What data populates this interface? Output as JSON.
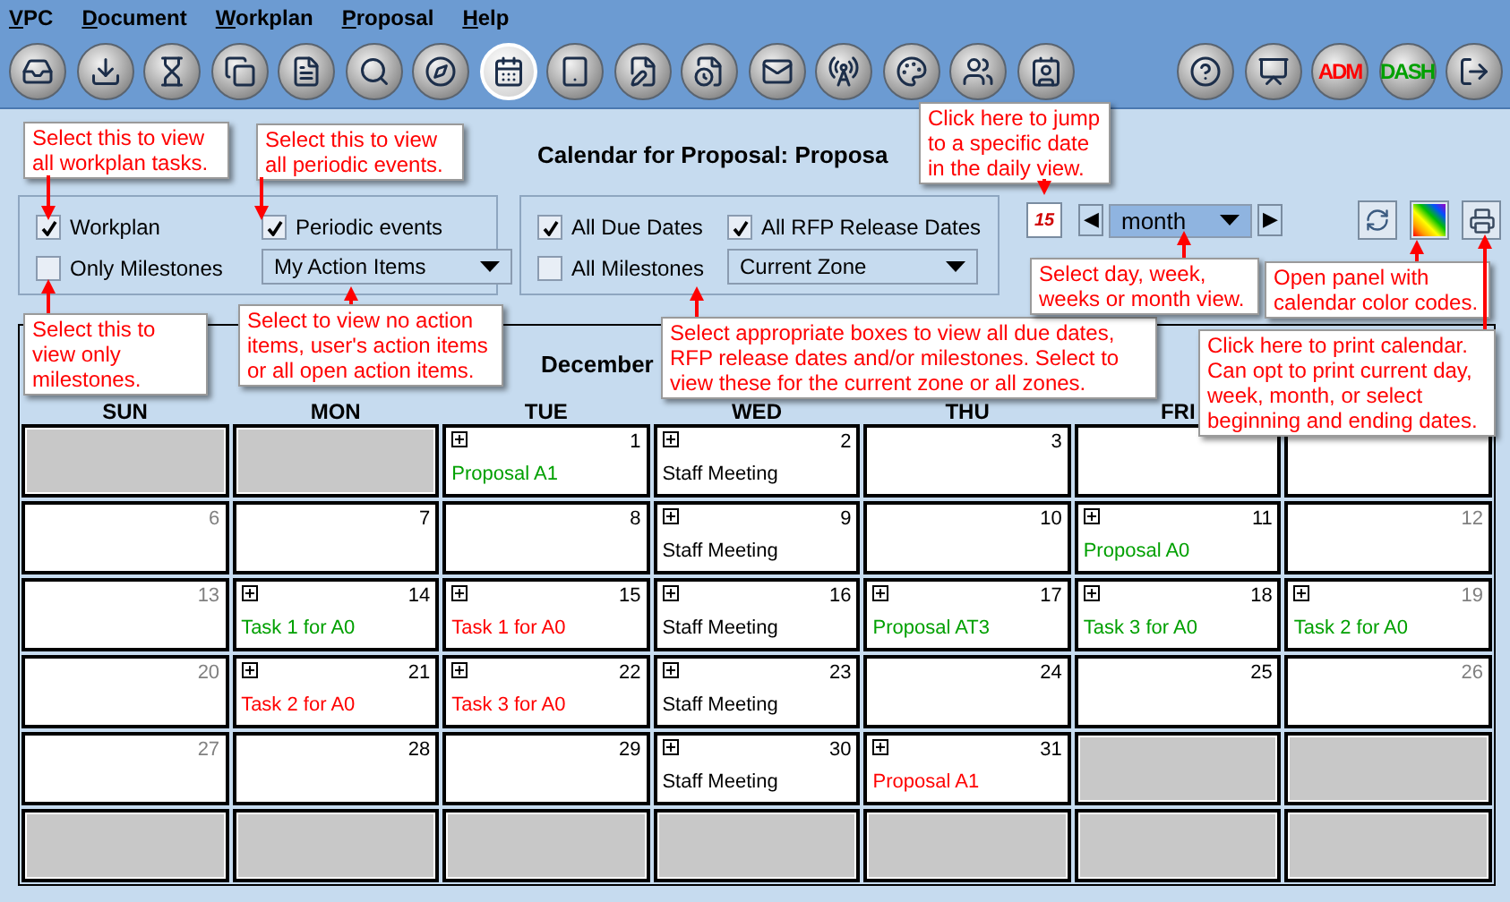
{
  "menu": [
    {
      "label": "VPC"
    },
    {
      "label": "Document"
    },
    {
      "label": "Workplan"
    },
    {
      "label": "Proposal"
    },
    {
      "label": "Help"
    }
  ],
  "toolbar": {
    "left": [
      {
        "kind": "icon",
        "selected": false
      },
      {
        "kind": "icon",
        "selected": false
      },
      {
        "kind": "icon",
        "selected": false
      },
      {
        "kind": "icon",
        "selected": false
      },
      {
        "kind": "icon",
        "selected": false
      },
      {
        "kind": "icon",
        "selected": false
      },
      {
        "kind": "icon",
        "selected": false
      },
      {
        "kind": "icon",
        "selected": true
      },
      {
        "kind": "icon",
        "selected": false
      },
      {
        "kind": "icon",
        "selected": false
      },
      {
        "kind": "icon",
        "selected": false
      },
      {
        "kind": "icon",
        "selected": false
      },
      {
        "kind": "icon",
        "selected": false
      },
      {
        "kind": "icon",
        "selected": false
      },
      {
        "kind": "icon",
        "selected": false
      },
      {
        "kind": "icon",
        "selected": false
      }
    ],
    "right": [
      {
        "kind": "icon",
        "selected": false
      },
      {
        "kind": "icon",
        "selected": false
      },
      {
        "kind": "text",
        "label": "ADM",
        "selected": false
      },
      {
        "kind": "text",
        "label": "DASH",
        "selected": false
      },
      {
        "kind": "icon",
        "selected": false
      }
    ]
  },
  "title": "Calendar for Proposal: Proposa",
  "filters": {
    "left": {
      "checkboxes": [
        {
          "label": "Workplan",
          "checked": true
        },
        {
          "label": "Periodic events",
          "checked": true
        },
        {
          "label": "Only Milestones",
          "checked": false
        }
      ],
      "dropdown": {
        "value": "My Action Items"
      }
    },
    "right": {
      "checkboxes": [
        {
          "label": "All Due Dates",
          "checked": true
        },
        {
          "label": "All RFP Release Dates",
          "checked": true
        },
        {
          "label": "All Milestones",
          "checked": false
        }
      ],
      "dropdown": {
        "value": "Current Zone"
      }
    }
  },
  "view": {
    "date_button": "15",
    "prev": "◀",
    "mode": "month",
    "next": "▶"
  },
  "calendar": {
    "month": "December",
    "weekdays": [
      "SUN",
      "MON",
      "TUE",
      "WED",
      "THU",
      "FRI"
    ],
    "weeks": [
      [
        {
          "kind": "blank"
        },
        {
          "kind": "blank"
        },
        {
          "kind": "day",
          "day": "1",
          "expandable": true,
          "event": "Proposal A1",
          "color": "#00a000"
        },
        {
          "kind": "day",
          "day": "2",
          "expandable": true,
          "event": "Staff Meeting",
          "color": "#000000"
        },
        {
          "kind": "day",
          "day": "3",
          "expandable": false
        },
        {
          "kind": "day",
          "expandable": false
        },
        {
          "kind": "day",
          "expandable": false
        }
      ],
      [
        {
          "kind": "day",
          "day": "6",
          "expandable": false
        },
        {
          "kind": "day",
          "day": "7",
          "expandable": false
        },
        {
          "kind": "day",
          "day": "8",
          "expandable": false
        },
        {
          "kind": "day",
          "day": "9",
          "expandable": true,
          "event": "Staff Meeting",
          "color": "#000000"
        },
        {
          "kind": "day",
          "day": "10",
          "expandable": false
        },
        {
          "kind": "day",
          "day": "11",
          "expandable": true,
          "event": "Proposal A0",
          "color": "#00a000"
        },
        {
          "kind": "day",
          "day": "12",
          "expandable": false
        }
      ],
      [
        {
          "kind": "day",
          "day": "13",
          "expandable": false
        },
        {
          "kind": "day",
          "day": "14",
          "expandable": true,
          "event": "Task 1 for A0",
          "color": "#00a000"
        },
        {
          "kind": "day",
          "day": "15",
          "expandable": true,
          "event": "Task 1 for A0",
          "color": "#ff0000"
        },
        {
          "kind": "day",
          "day": "16",
          "expandable": true,
          "event": "Staff Meeting",
          "color": "#000000"
        },
        {
          "kind": "day",
          "day": "17",
          "expandable": true,
          "event": "Proposal AT3",
          "color": "#00a000"
        },
        {
          "kind": "day",
          "day": "18",
          "expandable": true,
          "event": "Task 3 for A0",
          "color": "#00a000"
        },
        {
          "kind": "day",
          "day": "19",
          "expandable": true,
          "event": "Task 2 for A0",
          "color": "#00a000"
        }
      ],
      [
        {
          "kind": "day",
          "day": "20",
          "expandable": false
        },
        {
          "kind": "day",
          "day": "21",
          "expandable": true,
          "event": "Task 2 for A0",
          "color": "#ff0000"
        },
        {
          "kind": "day",
          "day": "22",
          "expandable": true,
          "event": "Task 3 for A0",
          "color": "#ff0000"
        },
        {
          "kind": "day",
          "day": "23",
          "expandable": true,
          "event": "Staff Meeting",
          "color": "#000000"
        },
        {
          "kind": "day",
          "day": "24",
          "expandable": false
        },
        {
          "kind": "day",
          "day": "25",
          "expandable": false
        },
        {
          "kind": "day",
          "day": "26",
          "expandable": false
        }
      ],
      [
        {
          "kind": "day",
          "day": "27",
          "expandable": false
        },
        {
          "kind": "day",
          "day": "28",
          "expandable": false
        },
        {
          "kind": "day",
          "day": "29",
          "expandable": false
        },
        {
          "kind": "day",
          "day": "30",
          "expandable": true,
          "event": "Staff Meeting",
          "color": "#000000"
        },
        {
          "kind": "day",
          "day": "31",
          "expandable": true,
          "event": "Proposal A1",
          "color": "#ff0000"
        },
        {
          "kind": "blank"
        },
        {
          "kind": "blank"
        }
      ],
      [
        {
          "kind": "blank"
        },
        {
          "kind": "blank"
        },
        {
          "kind": "blank"
        },
        {
          "kind": "blank"
        },
        {
          "kind": "blank"
        },
        {
          "kind": "blank"
        },
        {
          "kind": "blank"
        }
      ]
    ]
  },
  "callouts": [
    {
      "text": "Select this to view all workplan tasks."
    },
    {
      "text": "Select this to view all periodic events."
    },
    {
      "text": "Click here to jump to a specific date in the daily view."
    },
    {
      "text": "Select this to view only milestones."
    },
    {
      "text": "Select to view no action items, user's action items or all open action items."
    },
    {
      "text": "Select appropriate boxes to view all due dates, RFP release dates and/or milestones.  Select to view these for the current zone or all zones."
    },
    {
      "text": "Select day, week, weeks or month view."
    },
    {
      "text": "Open panel with calendar color codes."
    },
    {
      "text": "Click here to print calendar. Can opt to print current day, week, month, or select beginning and ending dates."
    }
  ]
}
